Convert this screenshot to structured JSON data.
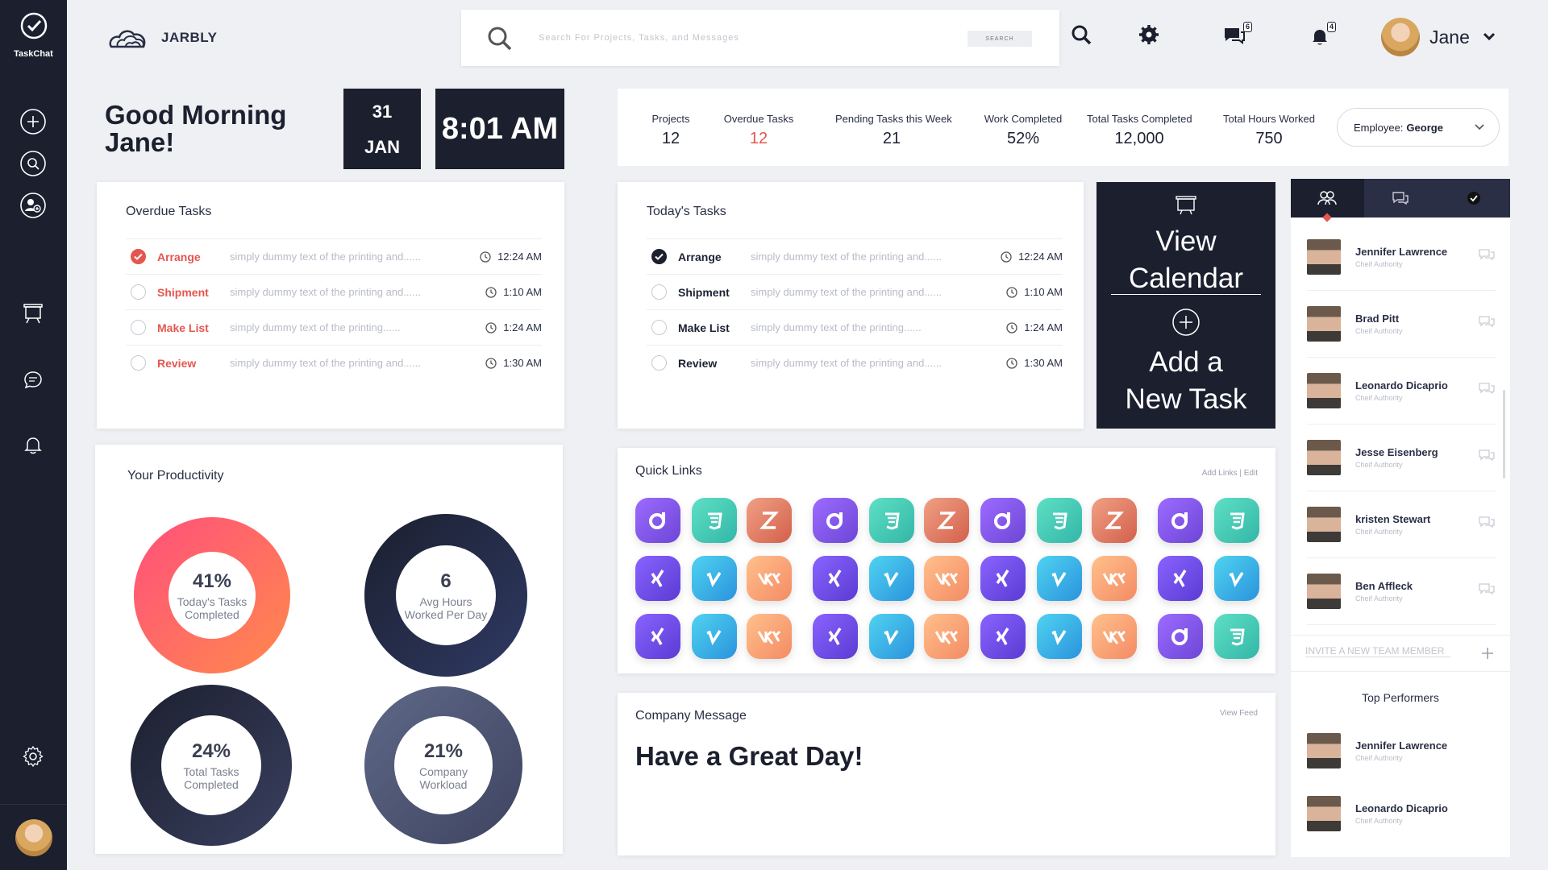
{
  "brand": {
    "sidebar_app": "TaskChat",
    "logo_text": "JARBLY"
  },
  "search": {
    "placeholder": "Search For Projects, Tasks, and Messages",
    "button": "SEARCH"
  },
  "notifications": {
    "messages_count": "6",
    "alerts_count": "4"
  },
  "user": {
    "name": "Jane"
  },
  "greeting": {
    "line1": "Good Morning",
    "line2": "Jane!"
  },
  "date": {
    "day": "31",
    "month": "JAN"
  },
  "time": "8:01 AM",
  "stats": [
    {
      "label": "Projects",
      "value": "12"
    },
    {
      "label": "Overdue Tasks",
      "value": "12"
    },
    {
      "label": "Pending Tasks this Week",
      "value": "21"
    },
    {
      "label": "Work Completed",
      "value": "52%"
    },
    {
      "label": "Total Tasks Completed",
      "value": "12,000"
    },
    {
      "label": "Total Hours Worked",
      "value": "750"
    }
  ],
  "employee_select": {
    "label": "Employee:",
    "value": "George"
  },
  "overdue": {
    "title": "Overdue Tasks",
    "tasks": [
      {
        "name": "Arrange",
        "desc": "simply dummy text of the printing and......",
        "time": "12:24 AM",
        "checked": true
      },
      {
        "name": "Shipment",
        "desc": "simply dummy text of the printing and......",
        "time": "1:10 AM",
        "checked": false
      },
      {
        "name": "Make List",
        "desc": "simply dummy text of the printing......",
        "time": "1:24 AM",
        "checked": false
      },
      {
        "name": "Review",
        "desc": "simply dummy text of the printing and......",
        "time": "1:30 AM",
        "checked": false
      }
    ]
  },
  "today": {
    "title": "Today's Tasks",
    "tasks": [
      {
        "name": "Arrange",
        "desc": "simply dummy text of the printing and......",
        "time": "12:24 AM",
        "checked": true
      },
      {
        "name": "Shipment",
        "desc": "simply dummy text of the printing and......",
        "time": "1:10 AM",
        "checked": false
      },
      {
        "name": "Make List",
        "desc": "simply dummy text of the printing......",
        "time": "1:24 AM",
        "checked": false
      },
      {
        "name": "Review",
        "desc": "simply dummy text of the printing and......",
        "time": "1:30 AM",
        "checked": false
      }
    ]
  },
  "actions": {
    "calendar_line1": "View",
    "calendar_line2": "Calendar",
    "add_line1": "Add a",
    "add_line2": "New Task"
  },
  "productivity": {
    "title": "Your Productivity",
    "rings": [
      {
        "value": "41%",
        "label1": "Today's Tasks",
        "label2": "Completed"
      },
      {
        "value": "6",
        "label1": "Avg Hours",
        "label2": "Worked Per Day"
      },
      {
        "value": "24%",
        "label1": "Total Tasks",
        "label2": "Completed"
      },
      {
        "value": "21%",
        "label1": "Company",
        "label2": "Workload"
      }
    ]
  },
  "quick_links": {
    "title": "Quick Links",
    "action": "Add Links | Edit",
    "rows": [
      [
        "daily",
        "css",
        "zen",
        "daily",
        "css",
        "zen",
        "daily",
        "css",
        "zen",
        "daily",
        "css"
      ],
      [
        "xing",
        "vimeo",
        "vk",
        "xing",
        "vimeo",
        "vk",
        "xing",
        "vimeo",
        "vk",
        "xing",
        "vimeo"
      ],
      [
        "xing",
        "vimeo",
        "vk",
        "xing",
        "vimeo",
        "vk",
        "xing",
        "vimeo",
        "vk",
        "daily",
        "css"
      ]
    ]
  },
  "company_message": {
    "title": "Company Message",
    "action": "View Feed",
    "text": "Have a Great Day!"
  },
  "team": {
    "members": [
      {
        "name": "Jennifer Lawrence",
        "role": "Cheif Authority"
      },
      {
        "name": "Brad Pitt",
        "role": "Cheif Authority"
      },
      {
        "name": "Leonardo Dicaprio",
        "role": "Cheif Authority"
      },
      {
        "name": "Jesse Eisenberg",
        "role": "Cheif Authority"
      },
      {
        "name": "kristen Stewart",
        "role": "Cheif Authority"
      },
      {
        "name": "Ben Affleck",
        "role": "Cheif Authority"
      }
    ],
    "invite_placeholder": "INVITE A NEW TEAM MEMBER",
    "top_title": "Top Performers",
    "top_performers": [
      {
        "name": "Jennifer Lawrence",
        "role": "Cheif Authority"
      },
      {
        "name": "Leonardo Dicaprio",
        "role": "Cheif Authority"
      }
    ]
  },
  "colors": {
    "sidebar": "#1b1f2e",
    "accent_red": "#e5564f",
    "ring1_start": "#ff4f7b",
    "ring1_end": "#ff8a4c",
    "ring_dark": "#232a45",
    "ring_slate": "#5f6888"
  }
}
